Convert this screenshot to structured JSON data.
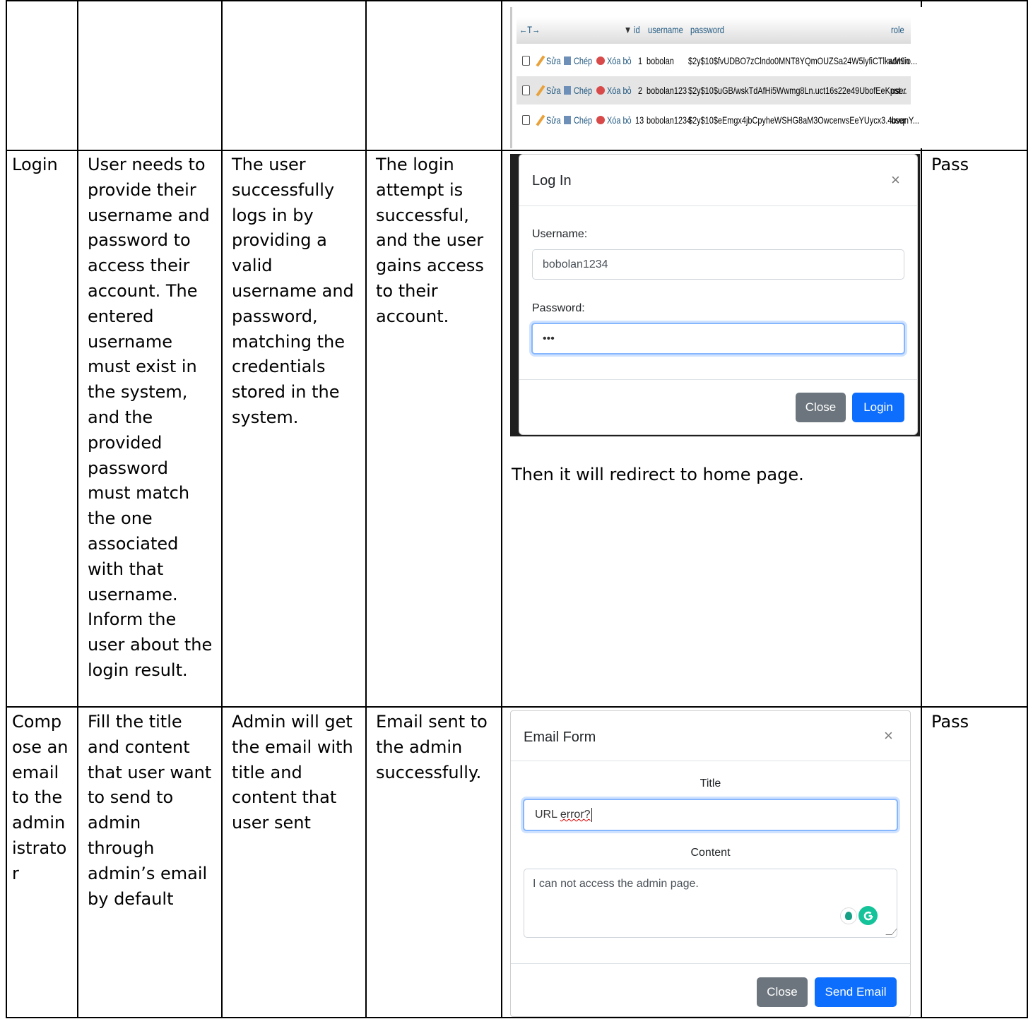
{
  "db_table": {
    "headers": {
      "arrows": "←T→",
      "sort": "▼",
      "id": "id",
      "username": "username",
      "password": "password",
      "role": "role"
    },
    "action_labels": {
      "edit": "Sửa",
      "copy": "Chép",
      "delete": "Xóa bỏ"
    },
    "rows": [
      {
        "id": "1",
        "username": "bobolan",
        "password": "$2y$10$fvUDBO7zClndo0MNT8YQmOUZSa24W5lyfiCTlkwM9io...",
        "role": "admin"
      },
      {
        "id": "2",
        "username": "bobolan123",
        "password": "$2y$10$uGB/wskTdAfHi5Wwmg8Ln.uct16s22e49UbofEeKpst...",
        "role": "user"
      },
      {
        "id": "13",
        "username": "bobolan1234",
        "password": "$2y$10$eEmgx4jbCpyheWSHG8aM3OwcenvsEeYUycx3.4bvqnY...",
        "role": "user"
      }
    ]
  },
  "rows": [
    {
      "feature": "Login",
      "description": "User needs to\nprovide their\nusername and\npassword to\naccess their\naccount. The\nentered\nusername\nmust exist in\nthe system,\nand the\nprovided\npassword\nmust match\nthe one\nassociated\nwith that\nusername.\nInform the\nuser about the\nlogin result.",
      "expected": "The user\nsuccessfully\nlogs in by\nproviding a\nvalid\nusername and\npassword,\nmatching the\ncredentials\nstored in the\nsystem.",
      "actual": "The login\nattempt is\nsuccessful,\nand the user\ngains access\nto their\naccount.",
      "note": "Then it will redirect to home page.",
      "result": "Pass"
    },
    {
      "feature": "Comp\nose an\nemail\nto the\nadmin\nistrato\nr",
      "description": "Fill the title\nand content\nthat user want\nto send to\nadmin\nthrough\nadmin’s email\nby default",
      "expected": "Admin will get\nthe email with\ntitle and\ncontent that\nuser sent",
      "actual": "Email sent to\nthe admin\nsuccessfully.",
      "result": "Pass"
    }
  ],
  "login_modal": {
    "title": "Log In",
    "close_glyph": "×",
    "username_label": "Username:",
    "username_value": "bobolan1234",
    "password_label": "Password:",
    "password_value": "•••",
    "close_button": "Close",
    "login_button": "Login"
  },
  "email_modal": {
    "title": "Email Form",
    "close_glyph": "×",
    "title_label": "Title",
    "title_value_prefix": "URL ",
    "title_value_misspelled": "error?",
    "content_label": "Content",
    "content_value": "I can not access the admin page.",
    "close_button": "Close",
    "send_button": "Send Email"
  }
}
